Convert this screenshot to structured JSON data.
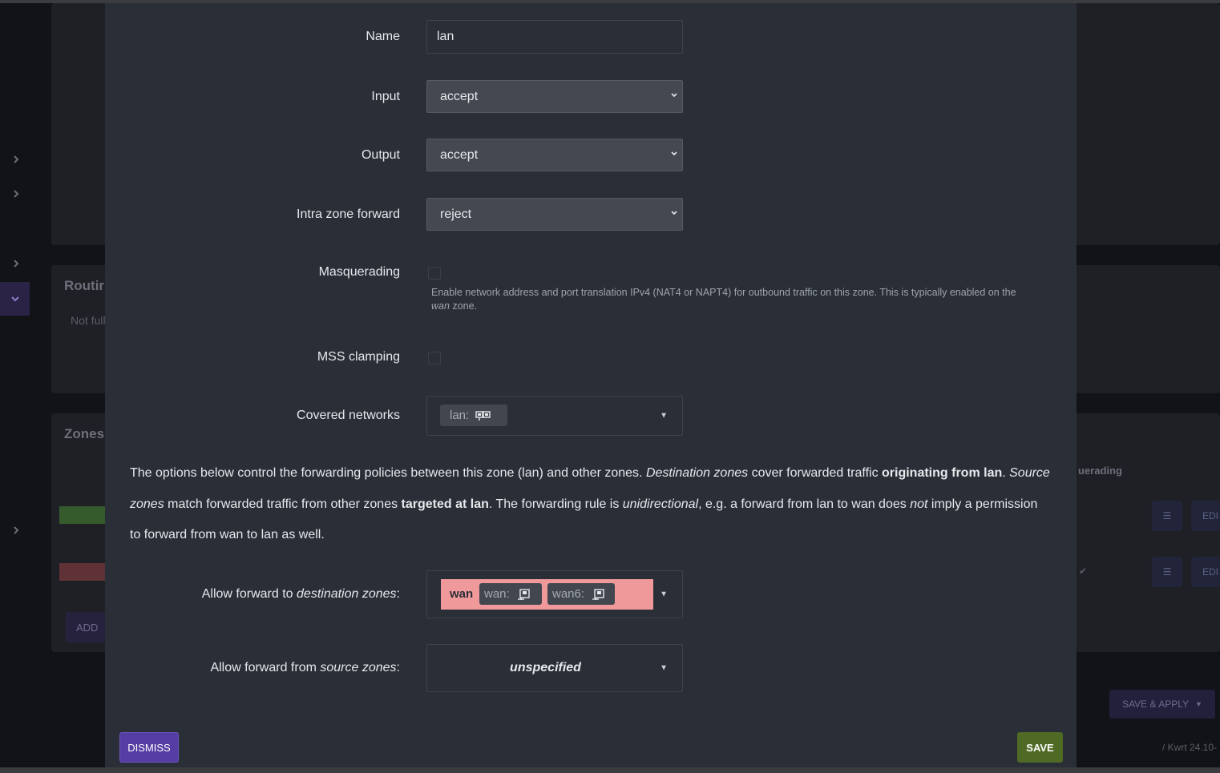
{
  "background": {
    "routing_title": "Routir",
    "routing_text": "Not full",
    "zones_title": "Zones",
    "add_label": "ADD",
    "masquerading_col": "uerading",
    "edit_label": "EDI",
    "menu_glyph": "☰",
    "check_glyph": "✔",
    "save_apply_label": "SAVE & APPLY",
    "footer_text": "/ Kwrt 24.10-"
  },
  "form": {
    "name_label": "Name",
    "name_value": "lan",
    "input_label": "Input",
    "input_value": "accept",
    "output_label": "Output",
    "output_value": "accept",
    "intra_label": "Intra zone forward",
    "intra_value": "reject",
    "masq_label": "Masquerading",
    "masq_help_1": "Enable network address and port translation IPv4 (NAT4 or NAPT4) for outbound traffic on this zone. This is typically enabled on the",
    "masq_help_wan": "wan",
    "masq_help_2": " zone.",
    "mss_label": "MSS clamping",
    "covered_label": "Covered networks",
    "covered_pill": "lan:"
  },
  "forwarding": {
    "para_1": "The options below control the forwarding policies between this zone (lan) and other zones. ",
    "para_dest_em": "Destination zones",
    "para_2": " cover forwarded traffic ",
    "para_orig_b": "originating from lan",
    "para_3": ". ",
    "para_src_em": "Source zones",
    "para_4": " match forwarded traffic from other zones ",
    "para_target_b": "targeted at lan",
    "para_5": ". The forwarding rule is ",
    "para_uni_em": "unidirectional",
    "para_6": ", e.g. a forward from lan to wan does ",
    "para_not_em": "not",
    "para_7": " imply a permission to forward from wan to lan as well.",
    "dest_label_1": "Allow forward to ",
    "dest_label_em": "destination zones",
    "dest_label_2": ":",
    "dest_zone": "wan",
    "dest_pill_1": "wan:",
    "dest_pill_2": "wan6:",
    "src_label_1": "Allow forward from ",
    "src_label_em": "source zones",
    "src_label_2": ":",
    "src_value": "unspecified"
  },
  "buttons": {
    "dismiss": "DISMISS",
    "save": "SAVE"
  },
  "colors": {
    "modal_bg": "#2a2e36",
    "dismiss": "#553da3",
    "save": "#4f6a24",
    "wan_zone": "#f0999b"
  }
}
